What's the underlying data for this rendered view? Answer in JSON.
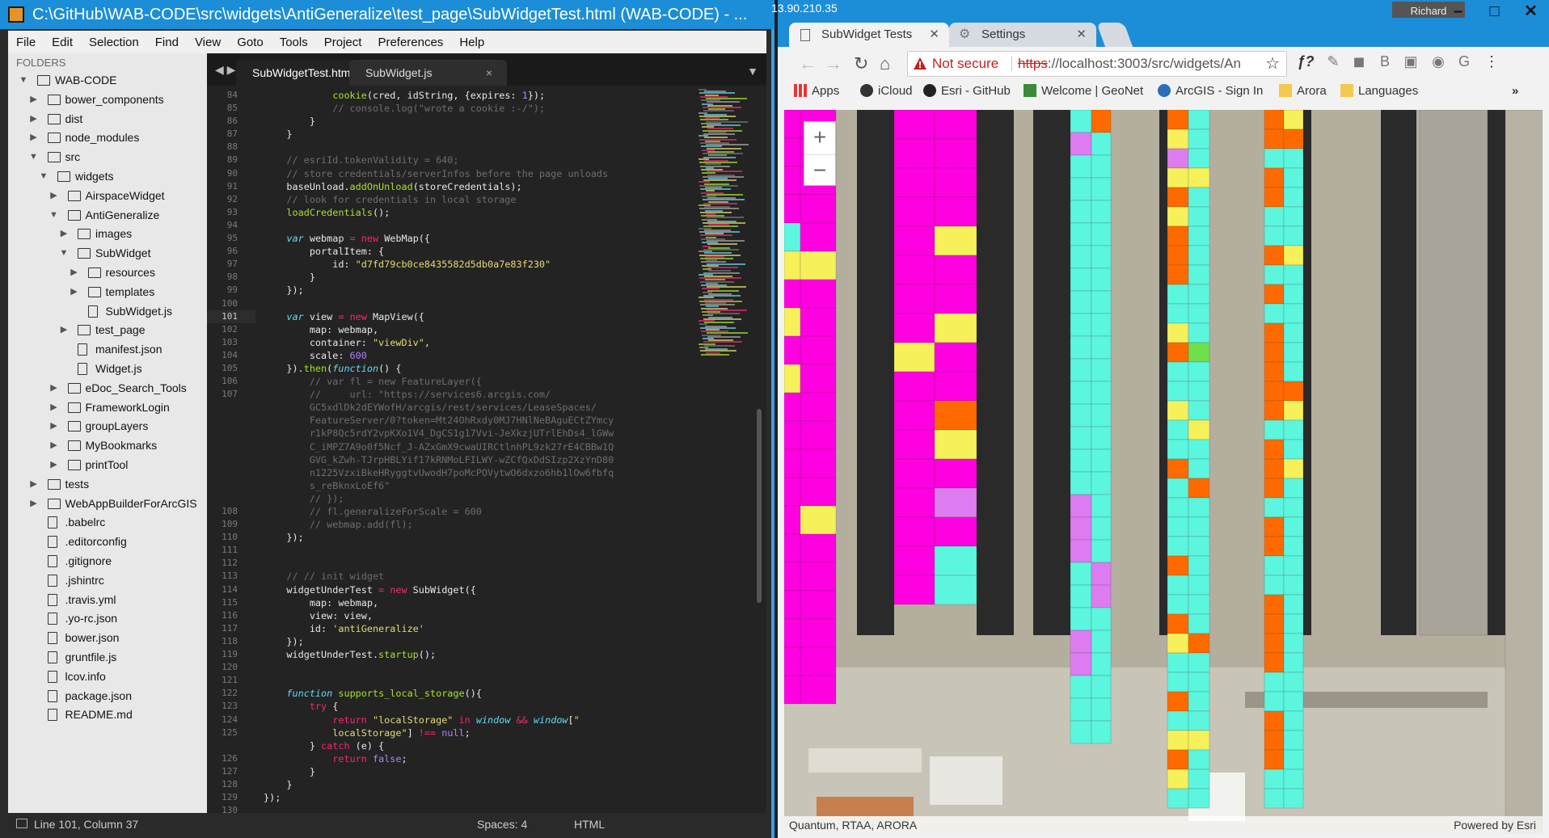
{
  "editor": {
    "window_title": "C:\\GitHub\\WAB-CODE\\src\\widgets\\AntiGeneralize\\test_page\\SubWidgetTest.html (WAB-CODE) - ...",
    "menu": [
      "File",
      "Edit",
      "Selection",
      "Find",
      "View",
      "Goto",
      "Tools",
      "Project",
      "Preferences",
      "Help"
    ],
    "sidebar_header": "FOLDERS",
    "tree": [
      {
        "label": "WAB-CODE",
        "type": "folder",
        "open": true,
        "depth": 0
      },
      {
        "label": "bower_components",
        "type": "folder",
        "open": false,
        "depth": 1
      },
      {
        "label": "dist",
        "type": "folder",
        "open": false,
        "depth": 1
      },
      {
        "label": "node_modules",
        "type": "folder",
        "open": false,
        "depth": 1
      },
      {
        "label": "src",
        "type": "folder",
        "open": true,
        "depth": 1
      },
      {
        "label": "widgets",
        "type": "folder",
        "open": true,
        "depth": 2
      },
      {
        "label": "AirspaceWidget",
        "type": "folder",
        "open": false,
        "depth": 3
      },
      {
        "label": "AntiGeneralize",
        "type": "folder",
        "open": true,
        "depth": 3
      },
      {
        "label": "images",
        "type": "folder",
        "open": false,
        "depth": 4
      },
      {
        "label": "SubWidget",
        "type": "folder",
        "open": true,
        "depth": 4
      },
      {
        "label": "resources",
        "type": "folder",
        "open": false,
        "depth": 5
      },
      {
        "label": "templates",
        "type": "folder",
        "open": false,
        "depth": 5
      },
      {
        "label": "SubWidget.js",
        "type": "file",
        "depth": 5
      },
      {
        "label": "test_page",
        "type": "folder",
        "open": false,
        "depth": 4
      },
      {
        "label": "manifest.json",
        "type": "file",
        "depth": 4
      },
      {
        "label": "Widget.js",
        "type": "file",
        "depth": 4
      },
      {
        "label": "eDoc_Search_Tools",
        "type": "folder",
        "open": false,
        "depth": 3
      },
      {
        "label": "FrameworkLogin",
        "type": "folder",
        "open": false,
        "depth": 3
      },
      {
        "label": "groupLayers",
        "type": "folder",
        "open": false,
        "depth": 3
      },
      {
        "label": "MyBookmarks",
        "type": "folder",
        "open": false,
        "depth": 3
      },
      {
        "label": "printTool",
        "type": "folder",
        "open": false,
        "depth": 3
      },
      {
        "label": "tests",
        "type": "folder",
        "open": false,
        "depth": 1
      },
      {
        "label": "WebAppBuilderForArcGIS",
        "type": "folder",
        "open": false,
        "depth": 1
      },
      {
        "label": ".babelrc",
        "type": "file",
        "depth": 1
      },
      {
        "label": ".editorconfig",
        "type": "file",
        "depth": 1
      },
      {
        "label": ".gitignore",
        "type": "file",
        "depth": 1
      },
      {
        "label": ".jshintrc",
        "type": "file",
        "depth": 1
      },
      {
        "label": ".travis.yml",
        "type": "file",
        "depth": 1
      },
      {
        "label": ".yo-rc.json",
        "type": "file",
        "depth": 1
      },
      {
        "label": "bower.json",
        "type": "file",
        "depth": 1
      },
      {
        "label": "gruntfile.js",
        "type": "file",
        "depth": 1
      },
      {
        "label": "lcov.info",
        "type": "file",
        "depth": 1
      },
      {
        "label": "package.json",
        "type": "file",
        "depth": 1
      },
      {
        "label": "README.md",
        "type": "file",
        "depth": 1
      }
    ],
    "tabs": [
      {
        "label": "SubWidgetTest.html",
        "active": true
      },
      {
        "label": "SubWidget.js",
        "active": false
      }
    ],
    "current_line": "101",
    "gutter": [
      "84",
      "85",
      "86",
      "87",
      "88",
      "89",
      "90",
      "91",
      "92",
      "93",
      "94",
      "95",
      "96",
      "97",
      "98",
      "99",
      "100",
      "101",
      "102",
      "103",
      "104",
      "105",
      "106",
      "107",
      "",
      "",
      "",
      "",
      "",
      "",
      "",
      "",
      "108",
      "109",
      "110",
      "111",
      "112",
      "113",
      "114",
      "115",
      "116",
      "117",
      "118",
      "119",
      "120",
      "121",
      "122",
      "123",
      "124",
      "125",
      "",
      "126",
      "127",
      "128",
      "129",
      "130"
    ],
    "code": [
      [
        [
          "            ",
          ""
        ],
        [
          "cookie",
          "fn"
        ],
        [
          "(cred, idString, {expires: ",
          ""
        ],
        [
          "1",
          "nm"
        ],
        [
          "});",
          ""
        ]
      ],
      [
        [
          "            // console.log(\"wrote a cookie :-/\");",
          "cm"
        ]
      ],
      [
        [
          "        }",
          ""
        ]
      ],
      [
        [
          "    }",
          ""
        ]
      ],
      [
        [
          "",
          ""
        ]
      ],
      [
        [
          "    // esriId.tokenValidity = 640;",
          "cm"
        ]
      ],
      [
        [
          "    // store credentials/serverInfos before the page unloads",
          "cm"
        ]
      ],
      [
        [
          "    baseUnload.",
          ""
        ],
        [
          "addOnUnload",
          "fn"
        ],
        [
          "(storeCredentials);",
          ""
        ]
      ],
      [
        [
          "    // look for credentials in local storage",
          "cm"
        ]
      ],
      [
        [
          "    ",
          ""
        ],
        [
          "loadCredentials",
          "fn"
        ],
        [
          "();",
          ""
        ]
      ],
      [
        [
          "",
          ""
        ]
      ],
      [
        [
          "    ",
          ""
        ],
        [
          "var",
          "ty"
        ],
        [
          " webmap ",
          ""
        ],
        [
          "=",
          "kw"
        ],
        [
          " ",
          ""
        ],
        [
          "new",
          "kw"
        ],
        [
          " WebMap({",
          ""
        ]
      ],
      [
        [
          "        portalItem: {",
          ""
        ]
      ],
      [
        [
          "            id: ",
          ""
        ],
        [
          "\"d7fd79cb0ce8435582d5db0a7e83f230\"",
          "st"
        ]
      ],
      [
        [
          "        }",
          ""
        ]
      ],
      [
        [
          "    });",
          ""
        ]
      ],
      [
        [
          "",
          ""
        ]
      ],
      [
        [
          "    ",
          ""
        ],
        [
          "var",
          "ty"
        ],
        [
          " view ",
          ""
        ],
        [
          "=",
          "kw"
        ],
        [
          " ",
          ""
        ],
        [
          "new",
          "kw"
        ],
        [
          " MapView({",
          ""
        ]
      ],
      [
        [
          "        map: webmap,",
          ""
        ]
      ],
      [
        [
          "        container: ",
          ""
        ],
        [
          "\"viewDiv\"",
          "st"
        ],
        [
          ",",
          ""
        ]
      ],
      [
        [
          "        scale: ",
          ""
        ],
        [
          "600",
          "nm"
        ]
      ],
      [
        [
          "    }).",
          ""
        ],
        [
          "then",
          "fn"
        ],
        [
          "(",
          ""
        ],
        [
          "function",
          "ty"
        ],
        [
          "() {",
          ""
        ]
      ],
      [
        [
          "        // var fl = new FeatureLayer({",
          "cm"
        ]
      ],
      [
        [
          "        //     url: \"https://services6.arcgis.com/",
          "cm"
        ]
      ],
      [
        [
          "        GC5xdlDk2dEYWofH/arcgis/rest/services/LeaseSpaces/",
          "cm"
        ]
      ],
      [
        [
          "        FeatureServer/0?token=Mt24OhRxdy0MJ7HNlNeBAguECtZYmcy",
          "cm"
        ]
      ],
      [
        [
          "        r1kP8Qc5rdY2vpKXo1V4_DgCS1g17Vvi-JeXkzjUTrlEhDs4_lGWw",
          "cm"
        ]
      ],
      [
        [
          "        C_iMPZ7A9o0f5Ncf_J-AZxGmX9cwaUIRCtlnhPL9zk27rE4CBBw1Q",
          "cm"
        ]
      ],
      [
        [
          "        GVG_kZwh-TJrpHBLYif17kRNMoLFILWY-wZCfQxDdSIzp2XzYnD80",
          "cm"
        ]
      ],
      [
        [
          "        n1225VzxiBkeHRyggtvUwodH7poMcPOVytwO6dxzo6hb1lOw6fbfq",
          "cm"
        ]
      ],
      [
        [
          "        s_reBknxLoEf6\"",
          "cm"
        ]
      ],
      [
        [
          "        // });",
          "cm"
        ]
      ],
      [
        [
          "        // fl.generalizeForScale = 600",
          "cm"
        ]
      ],
      [
        [
          "        // webmap.add(fl);",
          "cm"
        ]
      ],
      [
        [
          "    });",
          ""
        ]
      ],
      [
        [
          "",
          ""
        ]
      ],
      [
        [
          "",
          ""
        ]
      ],
      [
        [
          "    // // init widget",
          "cm"
        ]
      ],
      [
        [
          "    widgetUnderTest ",
          ""
        ],
        [
          "=",
          "kw"
        ],
        [
          " ",
          ""
        ],
        [
          "new",
          "kw"
        ],
        [
          " SubWidget({",
          ""
        ]
      ],
      [
        [
          "        map: webmap,",
          ""
        ]
      ],
      [
        [
          "        view: view,",
          ""
        ]
      ],
      [
        [
          "        id: ",
          ""
        ],
        [
          "'antiGeneralize'",
          "st"
        ]
      ],
      [
        [
          "    });",
          ""
        ]
      ],
      [
        [
          "    widgetUnderTest.",
          ""
        ],
        [
          "startup",
          "fn"
        ],
        [
          "();",
          ""
        ]
      ],
      [
        [
          "",
          ""
        ]
      ],
      [
        [
          "",
          ""
        ]
      ],
      [
        [
          "    ",
          ""
        ],
        [
          "function",
          "ty"
        ],
        [
          " ",
          ""
        ],
        [
          "supports_local_storage",
          "fn"
        ],
        [
          "(){",
          ""
        ]
      ],
      [
        [
          "        ",
          ""
        ],
        [
          "try",
          "kw"
        ],
        [
          " {",
          ""
        ]
      ],
      [
        [
          "            ",
          ""
        ],
        [
          "return",
          "kw"
        ],
        [
          " ",
          ""
        ],
        [
          "\"localStorage\"",
          "st"
        ],
        [
          " ",
          ""
        ],
        [
          "in",
          "kw"
        ],
        [
          " ",
          ""
        ],
        [
          "window",
          "ty"
        ],
        [
          " ",
          ""
        ],
        [
          "&&",
          "kw"
        ],
        [
          " ",
          ""
        ],
        [
          "window",
          "ty"
        ],
        [
          "[",
          ""
        ],
        [
          "\"",
          "st"
        ]
      ],
      [
        [
          "            ",
          ""
        ],
        [
          "localStorage\"",
          "st"
        ],
        [
          "] ",
          ""
        ],
        [
          "!==",
          "kw"
        ],
        [
          " ",
          ""
        ],
        [
          "null",
          "nm"
        ],
        [
          ";",
          ""
        ]
      ],
      [
        [
          "        } ",
          ""
        ],
        [
          "catch",
          "kw"
        ],
        [
          " (e) {",
          ""
        ]
      ],
      [
        [
          "            ",
          ""
        ],
        [
          "return",
          "kw"
        ],
        [
          " ",
          ""
        ],
        [
          "false",
          "nm"
        ],
        [
          ";",
          ""
        ]
      ],
      [
        [
          "        }",
          ""
        ]
      ],
      [
        [
          "    }",
          ""
        ]
      ],
      [
        [
          "});",
          ""
        ]
      ]
    ],
    "status": {
      "position": "Line 101, Column 37",
      "spaces": "Spaces: 4",
      "syntax": "HTML"
    }
  },
  "browser": {
    "title_ip": "13.90.210.35",
    "user": "Richard",
    "tabs": [
      {
        "label": "SubWidget Tests",
        "active": true
      },
      {
        "label": "Settings",
        "active": false
      }
    ],
    "security": "Not secure",
    "url_scheme": "https",
    "url_rest": "://localhost:3003/src/widgets/An",
    "bookmarks": [
      "Apps",
      "iCloud",
      "Esri - GitHub",
      "Welcome | GeoNet",
      "ArcGIS - Sign In",
      "Arora",
      "Languages"
    ],
    "attribution_left": "Quantum, RTAA, ARORA",
    "attribution_right": "Powered by Esri",
    "colors": {
      "magenta": "#ff00e0",
      "cyan": "#5cf5de",
      "yellow": "#f6f05a",
      "orange": "#ff6a00",
      "violet": "#dd7cf0",
      "green": "#6ee04a",
      "accent": "#1c8ed8"
    }
  }
}
